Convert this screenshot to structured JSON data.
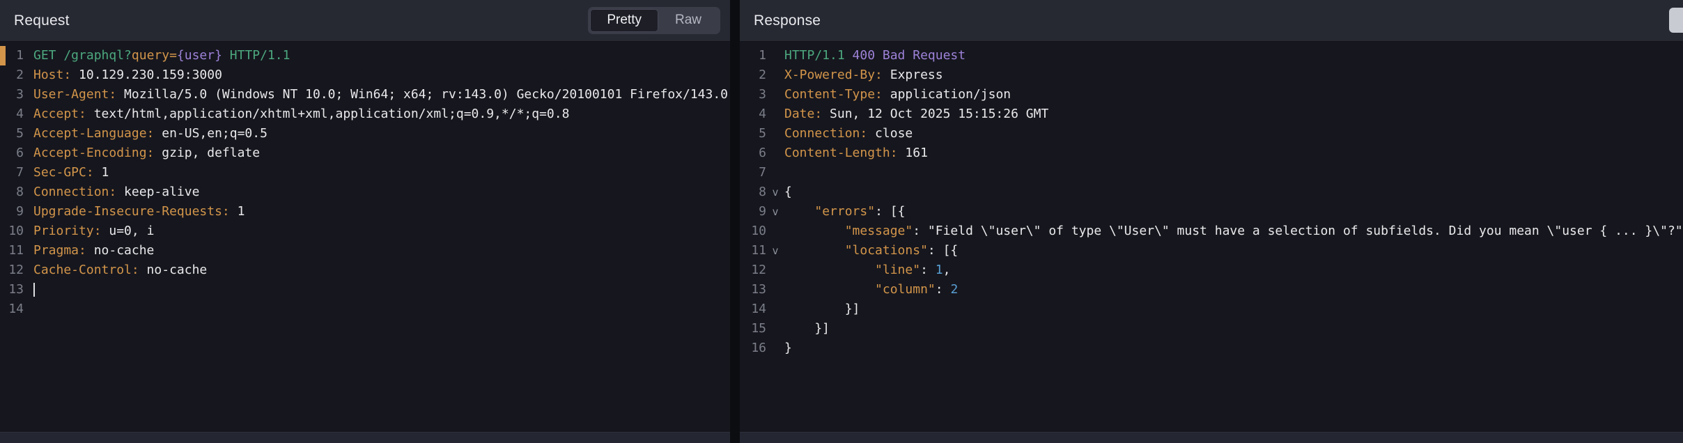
{
  "colors": {
    "teal": "#4ca77f",
    "orange": "#d2954a",
    "purple": "#9d82d8",
    "blue": "#5a9fd4",
    "plain": "#e9e9ec"
  },
  "request": {
    "title": "Request",
    "tabs": [
      {
        "label": "Pretty",
        "active": true
      },
      {
        "label": "Raw",
        "active": false
      }
    ],
    "lines": [
      {
        "no": 1,
        "segs": [
          [
            "teal",
            "GET /graphql?"
          ],
          [
            "orange",
            "query="
          ],
          [
            "purple",
            "{user}"
          ],
          [
            "teal",
            " HTTP/1.1"
          ]
        ]
      },
      {
        "no": 2,
        "segs": [
          [
            "orange",
            "Host:"
          ],
          [
            "plain",
            " 10.129.230.159:3000"
          ]
        ]
      },
      {
        "no": 3,
        "segs": [
          [
            "orange",
            "User-Agent:"
          ],
          [
            "plain",
            " Mozilla/5.0 (Windows NT 10.0; Win64; x64; rv:143.0) Gecko/20100101 Firefox/143.0"
          ]
        ]
      },
      {
        "no": 4,
        "segs": [
          [
            "orange",
            "Accept:"
          ],
          [
            "plain",
            " text/html,application/xhtml+xml,application/xml;q=0.9,*/*;q=0.8"
          ]
        ]
      },
      {
        "no": 5,
        "segs": [
          [
            "orange",
            "Accept-Language:"
          ],
          [
            "plain",
            " en-US,en;q=0.5"
          ]
        ]
      },
      {
        "no": 6,
        "segs": [
          [
            "orange",
            "Accept-Encoding:"
          ],
          [
            "plain",
            " gzip, deflate"
          ]
        ]
      },
      {
        "no": 7,
        "segs": [
          [
            "orange",
            "Sec-GPC:"
          ],
          [
            "plain",
            " 1"
          ]
        ]
      },
      {
        "no": 8,
        "segs": [
          [
            "orange",
            "Connection:"
          ],
          [
            "plain",
            " keep-alive"
          ]
        ]
      },
      {
        "no": 9,
        "segs": [
          [
            "orange",
            "Upgrade-Insecure-Requests:"
          ],
          [
            "plain",
            " 1"
          ]
        ]
      },
      {
        "no": 10,
        "segs": [
          [
            "orange",
            "Priority:"
          ],
          [
            "plain",
            " u=0, i"
          ]
        ]
      },
      {
        "no": 11,
        "segs": [
          [
            "orange",
            "Pragma:"
          ],
          [
            "plain",
            " no-cache"
          ]
        ]
      },
      {
        "no": 12,
        "segs": [
          [
            "orange",
            "Cache-Control:"
          ],
          [
            "plain",
            " no-cache"
          ]
        ]
      },
      {
        "no": 13,
        "segs": [],
        "caret": true
      },
      {
        "no": 14,
        "segs": []
      }
    ]
  },
  "response": {
    "title": "Response",
    "lines": [
      {
        "no": 1,
        "segs": [
          [
            "teal",
            "HTTP/1.1"
          ],
          [
            "purple",
            " 400 Bad Request"
          ]
        ]
      },
      {
        "no": 2,
        "segs": [
          [
            "orange",
            "X-Powered-By:"
          ],
          [
            "plain",
            " Express"
          ]
        ]
      },
      {
        "no": 3,
        "segs": [
          [
            "orange",
            "Content-Type:"
          ],
          [
            "plain",
            " application/json"
          ]
        ]
      },
      {
        "no": 4,
        "segs": [
          [
            "orange",
            "Date:"
          ],
          [
            "plain",
            " Sun, 12 Oct 2025 15:15:26 GMT"
          ]
        ]
      },
      {
        "no": 5,
        "segs": [
          [
            "orange",
            "Connection:"
          ],
          [
            "plain",
            " close"
          ]
        ]
      },
      {
        "no": 6,
        "segs": [
          [
            "orange",
            "Content-Length:"
          ],
          [
            "plain",
            " 161"
          ]
        ]
      },
      {
        "no": 7,
        "segs": []
      },
      {
        "no": 8,
        "fold": true,
        "segs": [
          [
            "plain",
            "{"
          ]
        ]
      },
      {
        "no": 9,
        "fold": true,
        "segs": [
          [
            "plain",
            "    "
          ],
          [
            "orange",
            "\"errors\""
          ],
          [
            "plain",
            ": [{"
          ]
        ]
      },
      {
        "no": 10,
        "segs": [
          [
            "plain",
            "        "
          ],
          [
            "orange",
            "\"message\""
          ],
          [
            "plain",
            ": \"Field \\\"user\\\" of type \\\"User\\\" must have a selection of subfields. Did you mean \\\"user { ... }\\\"?\","
          ]
        ]
      },
      {
        "no": 11,
        "fold": true,
        "segs": [
          [
            "plain",
            "        "
          ],
          [
            "orange",
            "\"locations\""
          ],
          [
            "plain",
            ": [{"
          ]
        ]
      },
      {
        "no": 12,
        "segs": [
          [
            "plain",
            "            "
          ],
          [
            "orange",
            "\"line\""
          ],
          [
            "plain",
            ": "
          ],
          [
            "blue",
            "1"
          ],
          [
            "plain",
            ","
          ]
        ]
      },
      {
        "no": 13,
        "segs": [
          [
            "plain",
            "            "
          ],
          [
            "orange",
            "\"column\""
          ],
          [
            "plain",
            ": "
          ],
          [
            "blue",
            "2"
          ]
        ]
      },
      {
        "no": 14,
        "segs": [
          [
            "plain",
            "        }]"
          ]
        ]
      },
      {
        "no": 15,
        "segs": [
          [
            "plain",
            "    }]"
          ]
        ]
      },
      {
        "no": 16,
        "segs": [
          [
            "plain",
            "}"
          ]
        ]
      }
    ]
  }
}
